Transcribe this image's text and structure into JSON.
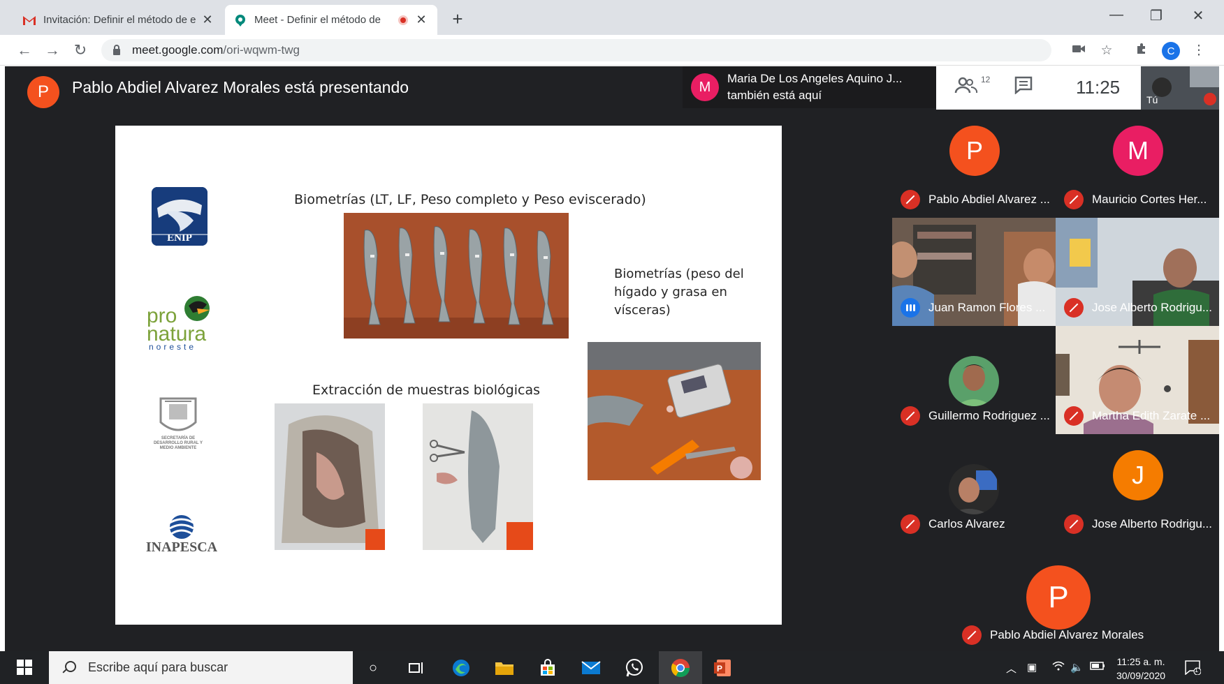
{
  "browser": {
    "tabs": [
      {
        "title": "Invitación: Definir el método de e",
        "icon": "gmail-icon",
        "active": false
      },
      {
        "title": "Meet - Definir el método de",
        "icon": "meet-icon",
        "active": true,
        "recording": true
      }
    ],
    "url_host": "meet.google.com",
    "url_path": "/ori-wqwm-twg",
    "profile_initial": "C"
  },
  "meet": {
    "presenter_initial": "P",
    "presenter_text": "Pablo Abdiel Alvarez Morales está presentando",
    "notice_initial": "M",
    "notice_line1": "Maria De Los Angeles Aquino J...",
    "notice_line2": "también está aquí",
    "participant_count": "12",
    "time": "11:25",
    "self_label": "Tú",
    "colors": {
      "presenter_avatar": "#f4511e",
      "notice_avatar": "#e91e63",
      "mic_off": "#d93025",
      "speaking": "#1a73e8"
    }
  },
  "slide": {
    "heading_biometrias": "Biometrías (LT, LF, Peso completo y Peso eviscerado)",
    "heading_extraccion": "Extracción de muestras biológicas",
    "para_line1": "Biometrías (peso del",
    "para_line2": "hígado y grasa en",
    "para_line3": "vísceras)",
    "logo_enip": "ENIP",
    "logo_pro": "pro",
    "logo_natura": "natura",
    "logo_noreste": "noreste",
    "logo_inapesca": "INAPESCA",
    "logo_secretaria": "SECRETARÍA DE DESARROLLO RURAL Y MEDIO AMBIENTE"
  },
  "participants": [
    {
      "name": "Pablo Abdiel Alvarez ...",
      "initial": "P",
      "color": "#f4511e",
      "type": "avatar",
      "mic": "off"
    },
    {
      "name": "Mauricio Cortes Her...",
      "initial": "M",
      "color": "#e91e63",
      "type": "avatar",
      "mic": "off"
    },
    {
      "name": "Juan Ramon Flores ...",
      "type": "video",
      "mic": "speaking"
    },
    {
      "name": "Jose Alberto Rodrigu...",
      "type": "video",
      "mic": "off"
    },
    {
      "name": "Guillermo Rodriguez ...",
      "type": "photo",
      "mic": "off"
    },
    {
      "name": "Martha Edith Zarate ...",
      "type": "video",
      "mic": "off"
    },
    {
      "name": "Carlos Alvarez",
      "type": "photo",
      "mic": "off"
    },
    {
      "name": "Jose Alberto Rodrigu...",
      "initial": "J",
      "color": "#f57c00",
      "type": "avatar",
      "mic": "off"
    }
  ],
  "bottom_participant": {
    "name": "Pablo Abdiel Alvarez Morales",
    "initial": "P"
  },
  "taskbar": {
    "search_placeholder": "Escribe aquí para buscar",
    "time": "11:25 a. m.",
    "date": "30/09/2020",
    "notifications": "1"
  }
}
